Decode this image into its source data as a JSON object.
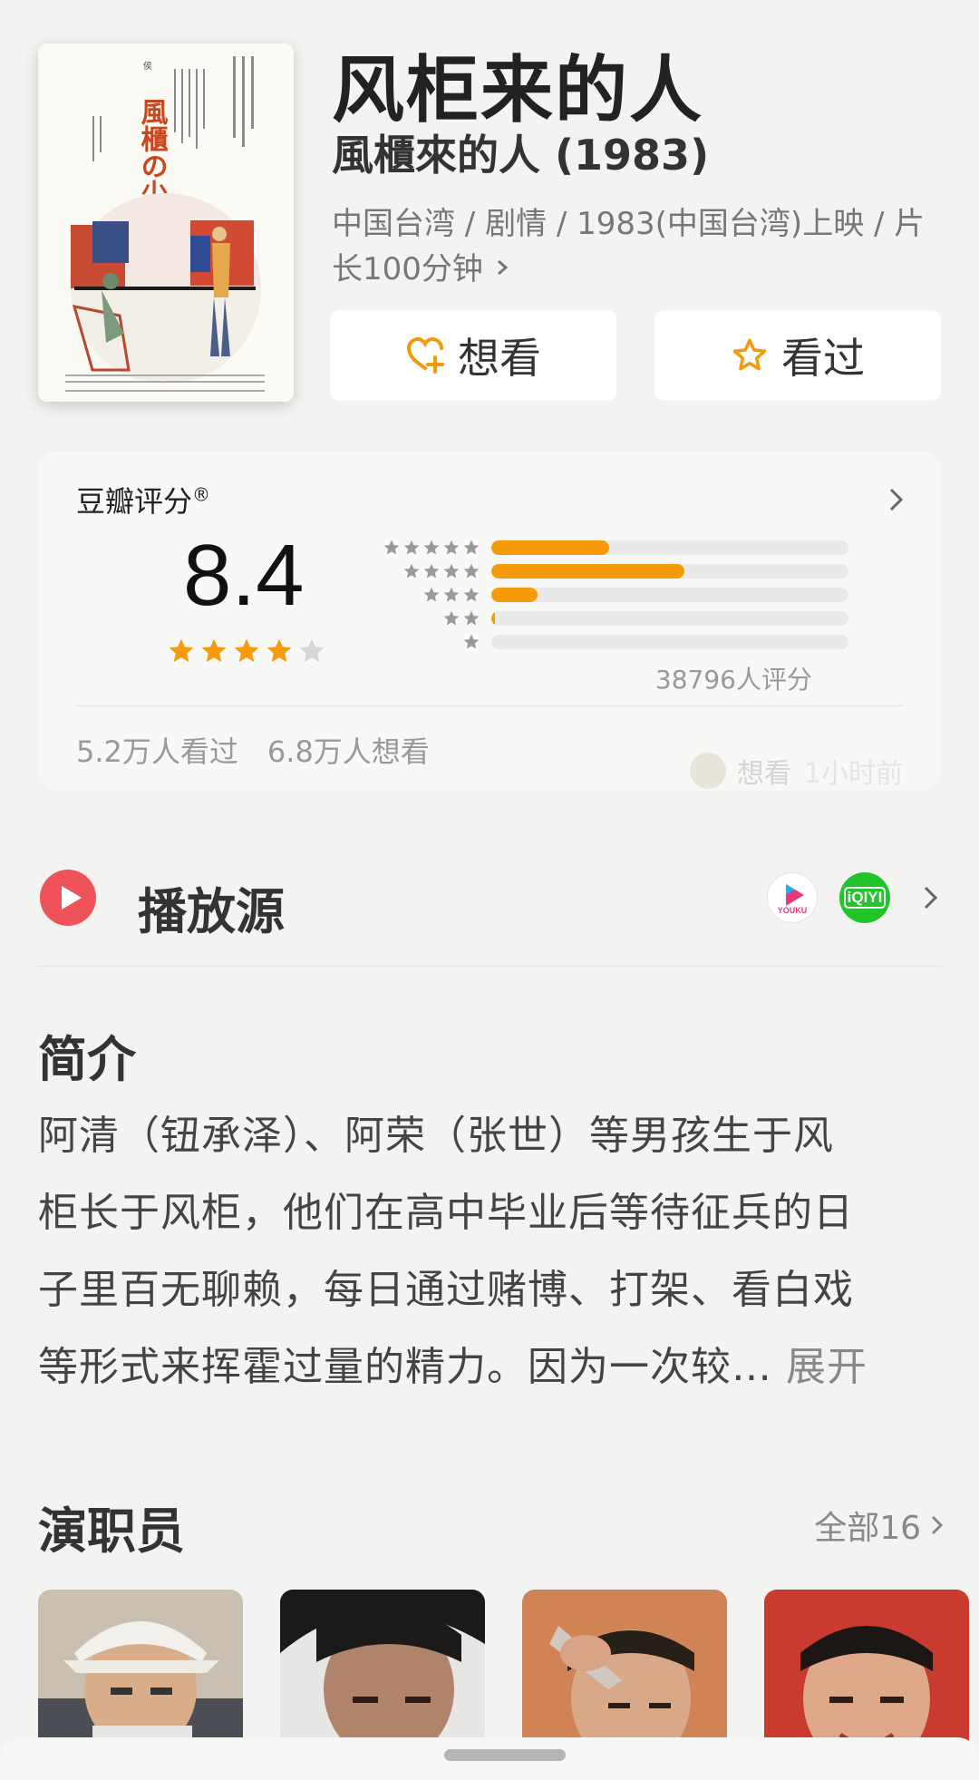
{
  "movie": {
    "title": "风柜来的人",
    "original_title": "風櫃來的人 (1983)",
    "meta": "中国台湾 / 剧情 / 1983(中国台湾)上映 / 片长100分钟",
    "poster_title": "風櫃の少年"
  },
  "actions": {
    "want_label": "想看",
    "seen_label": "看过"
  },
  "rating": {
    "label": "豆瓣评分",
    "reg_mark": "®",
    "score": "8.4",
    "stars": 4,
    "distribution": [
      {
        "stars": 5,
        "fraction": 0.33
      },
      {
        "stars": 4,
        "fraction": 0.54
      },
      {
        "stars": 3,
        "fraction": 0.13
      },
      {
        "stars": 2,
        "fraction": 0.01
      },
      {
        "stars": 1,
        "fraction": 0.0
      }
    ],
    "count_label": "38796人评分",
    "seen_count": "5.2万人看过",
    "want_count": "6.8万人想看"
  },
  "activity": {
    "action": "想看",
    "time": "1小时前"
  },
  "play_source": {
    "title": "播放源",
    "sources": [
      {
        "name": "youku-icon",
        "label": "YOUKU"
      },
      {
        "name": "iqiyi-icon",
        "label": "iQIYI"
      }
    ]
  },
  "synopsis": {
    "title": "简介",
    "lines": [
      "阿清（钮承泽）、阿荣（张世）等男孩生于风",
      "柜长于风柜，他们在高中毕业后等待征兵的日",
      "子里百无聊赖，每日通过赌博、打架、看白戏",
      "等形式来挥霍过量的精力。因为一次较…"
    ],
    "more_label": "展开"
  },
  "cast": {
    "title": "演职员",
    "all_label": "全部16"
  },
  "colors": {
    "accent": "#f59a08",
    "play_red": "#f0525a",
    "iqiyi_green": "#22c42c",
    "youku_pink": "#e73a7e",
    "background": "#f3f3f1"
  }
}
